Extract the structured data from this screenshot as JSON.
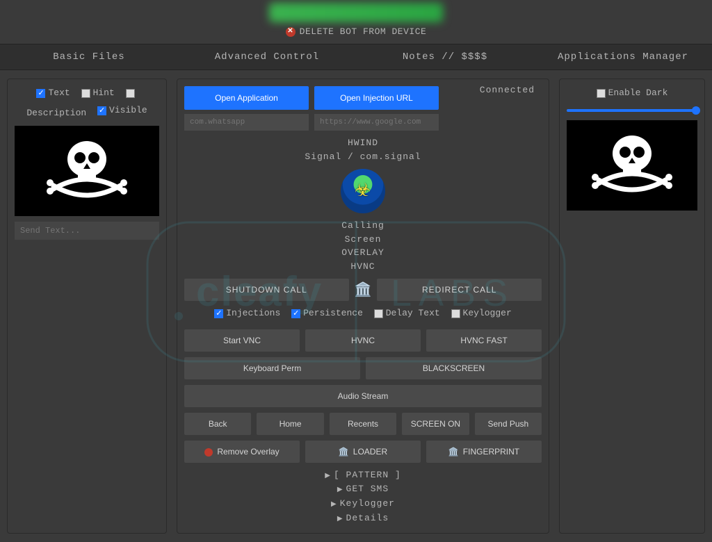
{
  "header": {
    "delete_label": "DELETE BOT FROM DEVICE"
  },
  "nav": {
    "basic_files": "Basic Files",
    "advanced_control": "Advanced Control",
    "notes": "Notes // $$$$",
    "apps_manager": "Applications Manager"
  },
  "left": {
    "text_label": "Text",
    "hint_label": "Hint",
    "description_label": "Description",
    "visible_label": "Visible",
    "send_text_placeholder": "Send Text..."
  },
  "center": {
    "open_app": "Open Application",
    "open_injection": "Open Injection URL",
    "app_input_placeholder": "com.whatsapp",
    "url_input_placeholder": "https://www.google.com",
    "hwind": "HWIND",
    "signal_line": "Signal / com.signal",
    "calling": "Calling",
    "screen": "Screen",
    "overlay": "OVERLAY",
    "hvnc": "HVNC",
    "shutdown_call": "SHUTDOWN CALL",
    "redirect_call": "REDIRECT CALL",
    "injections_label": "Injections",
    "persistence_label": "Persistence",
    "delay_text_label": "Delay Text",
    "keylogger_label": "Keylogger",
    "start_vnc": "Start VNC",
    "hvnc_btn": "HVNC",
    "hvnc_fast": "HVNC FAST",
    "keyboard_perm": "Keyboard Perm",
    "blackscreen": "BLACKSCREEN",
    "audio_stream": "Audio Stream",
    "back": "Back",
    "home": "Home",
    "recents": "Recents",
    "screen_on": "SCREEN ON",
    "send_push": "Send Push",
    "remove_overlay": "Remove Overlay",
    "loader": "LOADER",
    "fingerprint": "FINGERPRINT",
    "list": {
      "pattern": "[ PATTERN ]",
      "get_sms": "GET SMS",
      "keylogger_item": "Keylogger",
      "details": "Details"
    },
    "connected": "Connected"
  },
  "right": {
    "enable_dark": "Enable Dark"
  }
}
